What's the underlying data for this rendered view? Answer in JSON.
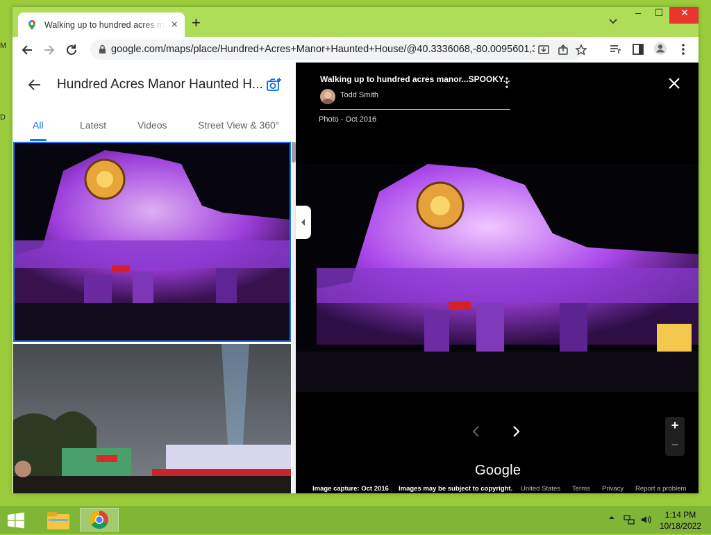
{
  "desktop": {
    "left_fragment_top": "M",
    "left_fragment_mid": "D"
  },
  "browser": {
    "tab_title": "Walking up to hundred acres manor",
    "tab_close": "×",
    "new_tab": "+",
    "url": "google.com/maps/place/Hundred+Acres+Manor+Haunted+House/@40.3336068,-80.0095601,3...",
    "window_controls": {
      "minimize": "–",
      "maximize": "☐",
      "close": "✕"
    }
  },
  "panel": {
    "title": "Hundred Acres Manor Haunted H...",
    "tabs": [
      "All",
      "Latest",
      "Videos",
      "Street View & 360°"
    ]
  },
  "viewer": {
    "title": "Walking up to hundred acres manor...SPOOKY...",
    "author": "Todd Smith",
    "date": "Photo - Oct 2016",
    "logo": "Google",
    "footer": {
      "capture": "Image capture: Oct 2016",
      "copyright": "Images may be subject to copyright.",
      "country": "United States",
      "terms": "Terms",
      "privacy": "Privacy",
      "report": "Report a problem"
    },
    "zoom_in": "+",
    "zoom_out": "−"
  },
  "taskbar": {
    "time": "1:14 PM",
    "date": "10/18/2022"
  },
  "colors": {
    "accent": "#1a73e8",
    "desktop": "#9acc3c",
    "taskbar": "#7fb636",
    "neon": "#b44dff"
  }
}
